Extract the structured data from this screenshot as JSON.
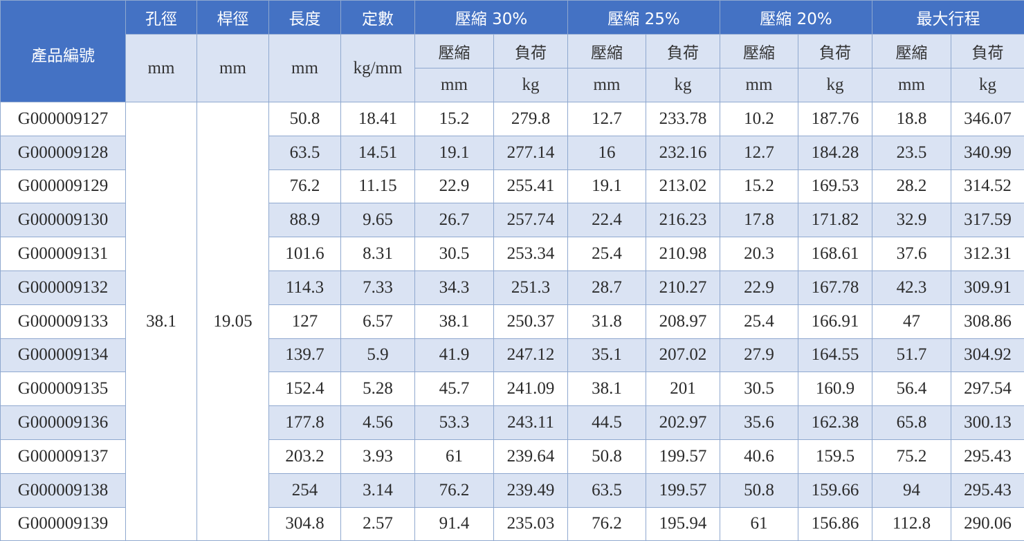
{
  "headers": {
    "product_no": "產品編號",
    "hole": "孔徑",
    "rod": "桿徑",
    "length": "長度",
    "constant": "定數",
    "comp30": "壓縮 30%",
    "comp25": "壓縮 25%",
    "comp20": "壓縮 20%",
    "max_stroke": "最大行程",
    "compress": "壓縮",
    "load": "負荷",
    "unit_mm": "mm",
    "unit_kgmm": "kg/mm",
    "unit_kg": "kg"
  },
  "shared": {
    "hole": "38.1",
    "rod": "19.05"
  },
  "rows": [
    [
      "G000009127",
      "50.8",
      "18.41",
      "15.2",
      "279.8",
      "12.7",
      "233.78",
      "10.2",
      "187.76",
      "18.8",
      "346.07"
    ],
    [
      "G000009128",
      "63.5",
      "14.51",
      "19.1",
      "277.14",
      "16",
      "232.16",
      "12.7",
      "184.28",
      "23.5",
      "340.99"
    ],
    [
      "G000009129",
      "76.2",
      "11.15",
      "22.9",
      "255.41",
      "19.1",
      "213.02",
      "15.2",
      "169.53",
      "28.2",
      "314.52"
    ],
    [
      "G000009130",
      "88.9",
      "9.65",
      "26.7",
      "257.74",
      "22.4",
      "216.23",
      "17.8",
      "171.82",
      "32.9",
      "317.59"
    ],
    [
      "G000009131",
      "101.6",
      "8.31",
      "30.5",
      "253.34",
      "25.4",
      "210.98",
      "20.3",
      "168.61",
      "37.6",
      "312.31"
    ],
    [
      "G000009132",
      "114.3",
      "7.33",
      "34.3",
      "251.3",
      "28.7",
      "210.27",
      "22.9",
      "167.78",
      "42.3",
      "309.91"
    ],
    [
      "G000009133",
      "127",
      "6.57",
      "38.1",
      "250.37",
      "31.8",
      "208.97",
      "25.4",
      "166.91",
      "47",
      "308.86"
    ],
    [
      "G000009134",
      "139.7",
      "5.9",
      "41.9",
      "247.12",
      "35.1",
      "207.02",
      "27.9",
      "164.55",
      "51.7",
      "304.92"
    ],
    [
      "G000009135",
      "152.4",
      "5.28",
      "45.7",
      "241.09",
      "38.1",
      "201",
      "30.5",
      "160.9",
      "56.4",
      "297.54"
    ],
    [
      "G000009136",
      "177.8",
      "4.56",
      "53.3",
      "243.11",
      "44.5",
      "202.97",
      "35.6",
      "162.38",
      "65.8",
      "300.13"
    ],
    [
      "G000009137",
      "203.2",
      "3.93",
      "61",
      "239.64",
      "50.8",
      "199.57",
      "40.6",
      "159.5",
      "75.2",
      "295.43"
    ],
    [
      "G000009138",
      "254",
      "3.14",
      "76.2",
      "239.49",
      "63.5",
      "199.57",
      "50.8",
      "159.66",
      "94",
      "295.43"
    ],
    [
      "G000009139",
      "304.8",
      "2.57",
      "91.4",
      "235.03",
      "76.2",
      "195.94",
      "61",
      "156.86",
      "112.8",
      "290.06"
    ]
  ]
}
